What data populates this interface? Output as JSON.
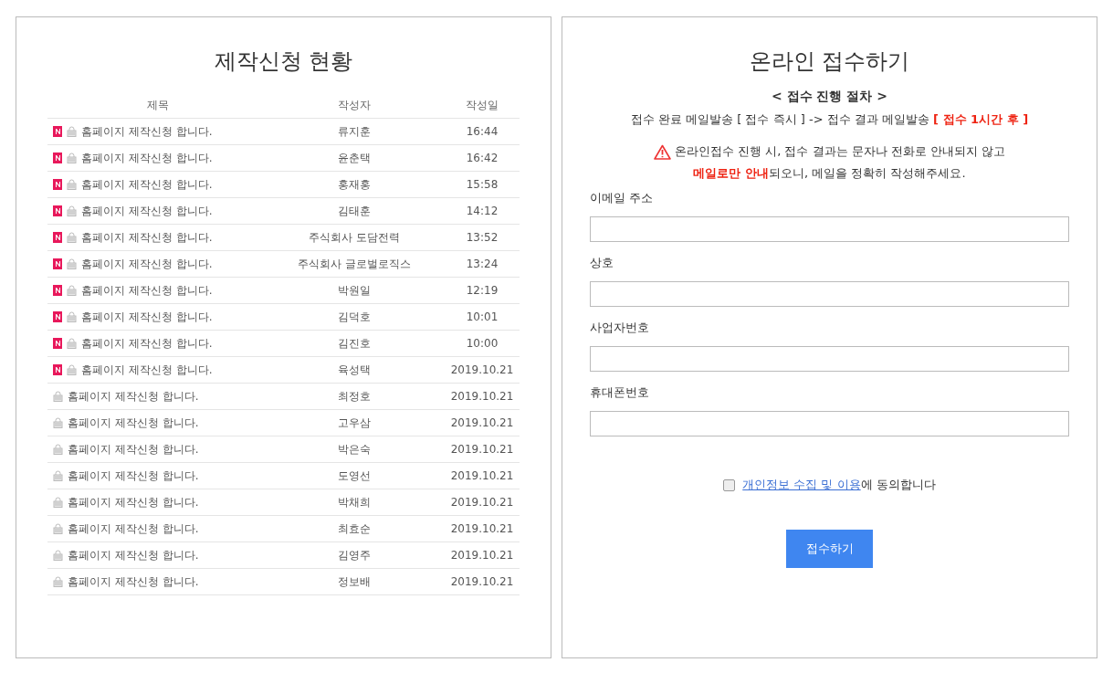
{
  "list_panel": {
    "title": "제작신청 현황",
    "columns": [
      "제목",
      "작성자",
      "작성일"
    ],
    "rows": [
      {
        "is_new": true,
        "title": "홈페이지 제작신청 합니다.",
        "author": "류지훈",
        "date": "16:44"
      },
      {
        "is_new": true,
        "title": "홈페이지 제작신청 합니다.",
        "author": "윤춘택",
        "date": "16:42"
      },
      {
        "is_new": true,
        "title": "홈페이지 제작신청 합니다.",
        "author": "홍재홍",
        "date": "15:58"
      },
      {
        "is_new": true,
        "title": "홈페이지 제작신청 합니다.",
        "author": "김태훈",
        "date": "14:12"
      },
      {
        "is_new": true,
        "title": "홈페이지 제작신청 합니다.",
        "author": "주식회사 도담전력",
        "date": "13:52"
      },
      {
        "is_new": true,
        "title": "홈페이지 제작신청 합니다.",
        "author": "주식회사 글로벌로직스",
        "date": "13:24"
      },
      {
        "is_new": true,
        "title": "홈페이지 제작신청 합니다.",
        "author": "박원일",
        "date": "12:19"
      },
      {
        "is_new": true,
        "title": "홈페이지 제작신청 합니다.",
        "author": "김덕호",
        "date": "10:01"
      },
      {
        "is_new": true,
        "title": "홈페이지 제작신청 합니다.",
        "author": "김진호",
        "date": "10:00"
      },
      {
        "is_new": true,
        "title": "홈페이지 제작신청 합니다.",
        "author": "육성택",
        "date": "2019.10.21"
      },
      {
        "is_new": false,
        "title": "홈페이지 제작신청 합니다.",
        "author": "최정호",
        "date": "2019.10.21"
      },
      {
        "is_new": false,
        "title": "홈페이지 제작신청 합니다.",
        "author": "고우삼",
        "date": "2019.10.21"
      },
      {
        "is_new": false,
        "title": "홈페이지 제작신청 합니다.",
        "author": "박은숙",
        "date": "2019.10.21"
      },
      {
        "is_new": false,
        "title": "홈페이지 제작신청 합니다.",
        "author": "도영선",
        "date": "2019.10.21"
      },
      {
        "is_new": false,
        "title": "홈페이지 제작신청 합니다.",
        "author": "박채희",
        "date": "2019.10.21"
      },
      {
        "is_new": false,
        "title": "홈페이지 제작신청 합니다.",
        "author": "최효순",
        "date": "2019.10.21"
      },
      {
        "is_new": false,
        "title": "홈페이지 제작신청 합니다.",
        "author": "김영주",
        "date": "2019.10.21"
      },
      {
        "is_new": false,
        "title": "홈페이지 제작신청 합니다.",
        "author": "정보배",
        "date": "2019.10.21"
      }
    ]
  },
  "form_panel": {
    "title": "온라인 접수하기",
    "procedure_heading": "< 접수 진행 절차 >",
    "procedure": "접수 완료 메일발송 [ 접수 즉시 ] -> 접수 결과 메일발송 **[ 접수 1시간 후 ]**",
    "warning_lines": [
      "온라인접수 진행 시, 접수 결과는 문자나 전화로 안내되지 않고",
      "**메일로만 안내**되오니, 메일을 정확히 작성해주세요."
    ],
    "fields": [
      {
        "label": "이메일 주소"
      },
      {
        "label": "상호"
      },
      {
        "label": "사업자번호"
      },
      {
        "label": "휴대폰번호"
      }
    ],
    "consent": {
      "checked": false,
      "link": "개인정보 수집 및 이용",
      "text": "에 동의합니다"
    },
    "submit": "접수하기"
  }
}
